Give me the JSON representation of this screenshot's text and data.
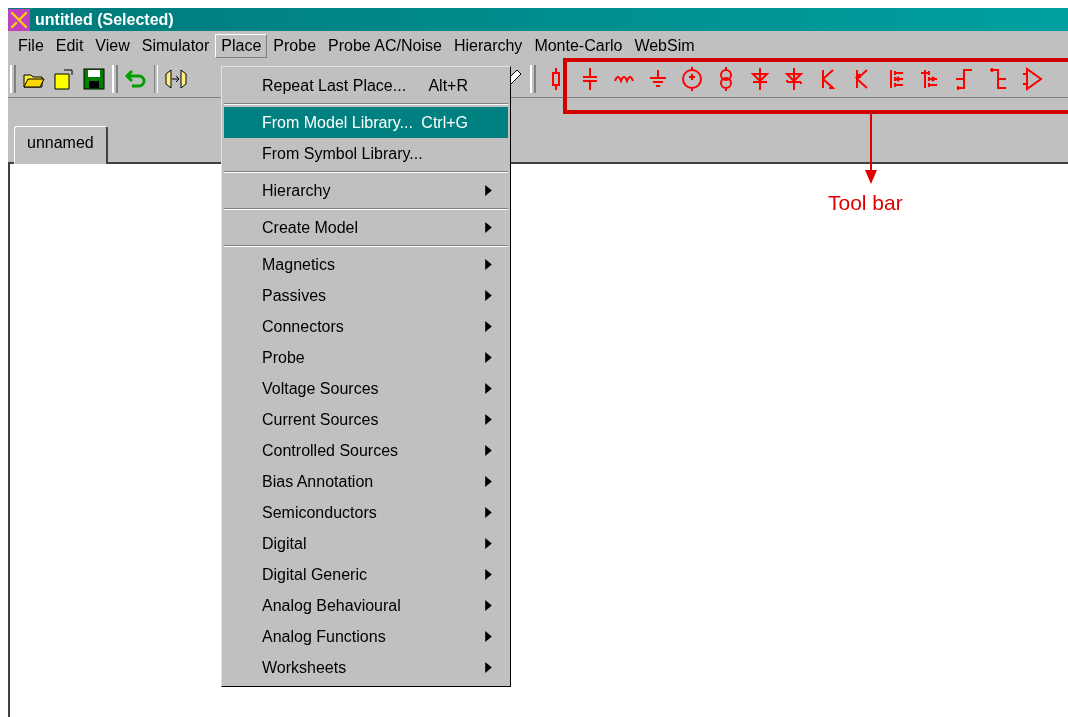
{
  "window": {
    "title": "untitled (Selected)"
  },
  "menu_bar": [
    {
      "label": "File",
      "selected": false
    },
    {
      "label": "Edit",
      "selected": false
    },
    {
      "label": "View",
      "selected": false
    },
    {
      "label": "Simulator",
      "selected": false
    },
    {
      "label": "Place",
      "selected": true
    },
    {
      "label": "Probe",
      "selected": false
    },
    {
      "label": "Probe AC/Noise",
      "selected": false
    },
    {
      "label": "Hierarchy",
      "selected": false
    },
    {
      "label": "Monte-Carlo",
      "selected": false
    },
    {
      "label": "WebSim",
      "selected": false
    }
  ],
  "place_menu": {
    "groups": [
      [
        {
          "label": "Repeat Last Place...",
          "shortcut": "Alt+R",
          "submenu": false,
          "selected": false
        }
      ],
      [
        {
          "label": "From Model Library...",
          "shortcut": "Ctrl+G",
          "submenu": false,
          "selected": true
        },
        {
          "label": "From Symbol Library...",
          "submenu": false,
          "selected": false
        }
      ],
      [
        {
          "label": "Hierarchy",
          "submenu": true,
          "selected": false
        }
      ],
      [
        {
          "label": "Create Model",
          "submenu": true,
          "selected": false
        }
      ],
      [
        {
          "label": "Magnetics",
          "submenu": true,
          "selected": false
        },
        {
          "label": "Passives",
          "submenu": true,
          "selected": false
        },
        {
          "label": "Connectors",
          "submenu": true,
          "selected": false
        },
        {
          "label": "Probe",
          "submenu": true,
          "selected": false
        },
        {
          "label": "Voltage Sources",
          "submenu": true,
          "selected": false
        },
        {
          "label": "Current Sources",
          "submenu": true,
          "selected": false
        },
        {
          "label": "Controlled Sources",
          "submenu": true,
          "selected": false
        },
        {
          "label": "Bias Annotation",
          "submenu": true,
          "selected": false
        },
        {
          "label": "Semiconductors",
          "submenu": true,
          "selected": false
        },
        {
          "label": "Digital",
          "submenu": true,
          "selected": false
        },
        {
          "label": "Digital Generic",
          "submenu": true,
          "selected": false
        },
        {
          "label": "Analog Behavioural",
          "submenu": true,
          "selected": false
        },
        {
          "label": "Analog Functions",
          "submenu": true,
          "selected": false
        },
        {
          "label": "Worksheets",
          "submenu": true,
          "selected": false
        }
      ]
    ]
  },
  "tabs": [
    {
      "label": "unnamed",
      "selected": true
    }
  ],
  "annotation": {
    "label": "Tool bar"
  }
}
